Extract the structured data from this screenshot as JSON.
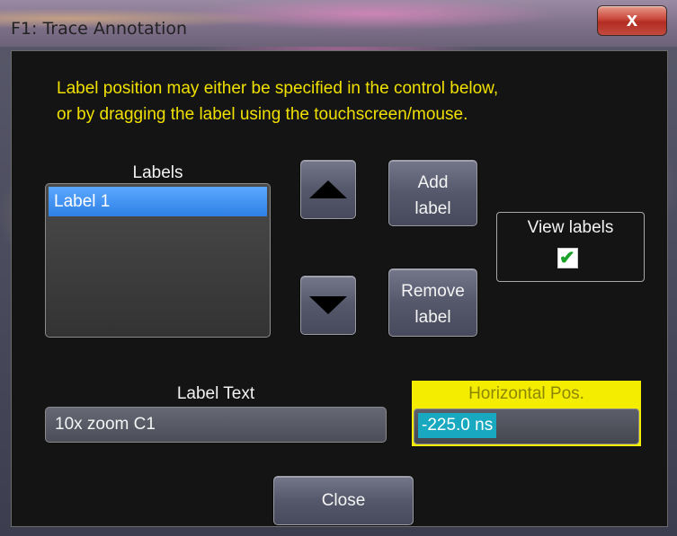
{
  "window": {
    "title": "F1: Trace Annotation",
    "close_glyph": "x"
  },
  "info_lines": [
    "Label position may either be specified in the control below,",
    "or by dragging the label using the touchscreen/mouse."
  ],
  "labels_list": {
    "heading": "Labels",
    "items": [
      "Label 1"
    ]
  },
  "buttons": {
    "move_up_icon": "up-arrow",
    "move_down_icon": "down-arrow",
    "add_line1": "Add",
    "add_line2": "label",
    "remove_line1": "Remove",
    "remove_line2": "label",
    "close": "Close"
  },
  "view_labels": {
    "label": "View labels",
    "checked": true
  },
  "label_text": {
    "heading": "Label Text",
    "value": "10x zoom C1"
  },
  "horizontal_pos": {
    "heading": "Horizontal Pos.",
    "value": "-225.0 ns"
  },
  "colors": {
    "prompt_text": "#f0e000",
    "highlight": "#f5ed00",
    "selection": "#2f80e6",
    "value_bg": "#18a8c0"
  }
}
